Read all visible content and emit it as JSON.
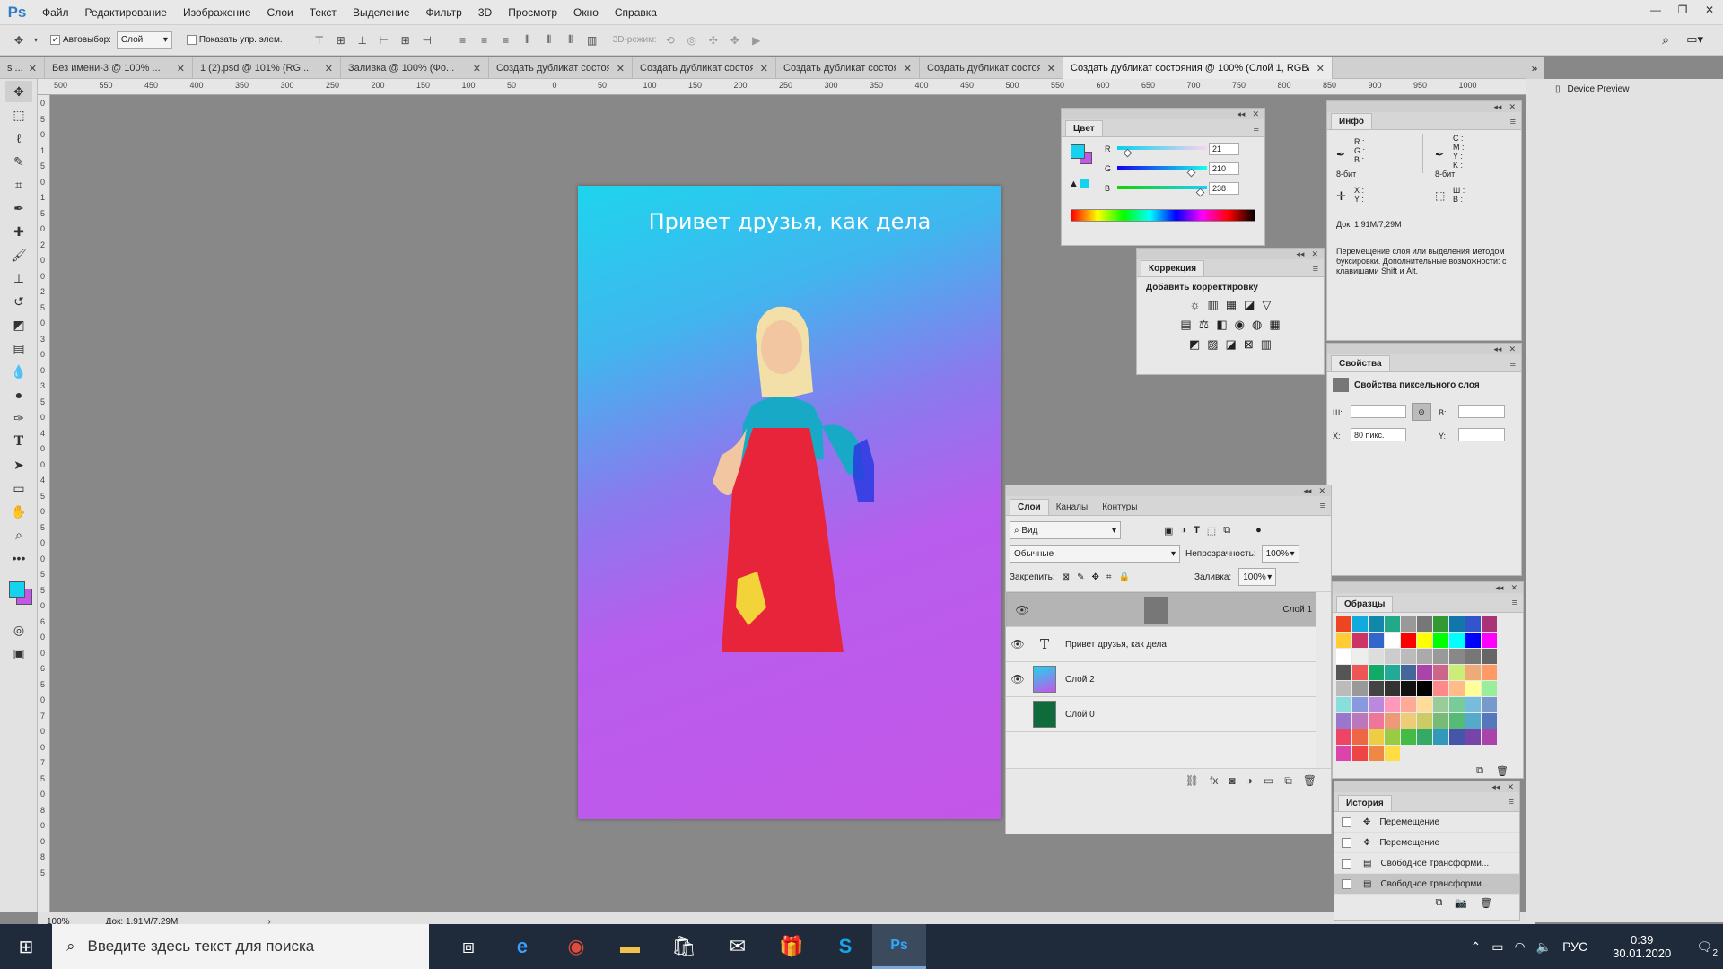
{
  "app": {
    "logo": "Ps"
  },
  "menu": [
    "Файл",
    "Редактирование",
    "Изображение",
    "Слои",
    "Текст",
    "Выделение",
    "Фильтр",
    "3D",
    "Просмотр",
    "Окно",
    "Справка"
  ],
  "options": {
    "autoselect_label": "Автовыбор:",
    "autoselect_value": "Слой",
    "show_controls_label": "Показать упр. элем.",
    "mode3d_label": "3D-режим:"
  },
  "doc_tabs": [
    {
      "label": "s ..."
    },
    {
      "label": "Без имени-3 @ 100% ..."
    },
    {
      "label": "1 (2).psd @ 101% (RG..."
    },
    {
      "label": "Заливка @ 100% (Фо..."
    },
    {
      "label": "Создать дубликат состояния"
    },
    {
      "label": "Создать дубликат состояния"
    },
    {
      "label": "Создать дубликат состояния"
    },
    {
      "label": "Создать дубликат состояния"
    },
    {
      "label": "Создать дубликат состояния @ 100% (Слой 1, RGB/16) *"
    }
  ],
  "ruler_h": [
    "500",
    "550",
    "450",
    "400",
    "350",
    "300",
    "250",
    "200",
    "150",
    "100",
    "50",
    "0",
    "50",
    "100",
    "150",
    "200",
    "250",
    "300",
    "350",
    "400",
    "450",
    "500",
    "550",
    "600",
    "650",
    "700",
    "750",
    "800",
    "850",
    "900",
    "950",
    "1000"
  ],
  "ruler_v": [
    "0",
    "5",
    "0",
    "1",
    "5",
    "0",
    "1",
    "5",
    "0",
    "2",
    "0",
    "0",
    "2",
    "5",
    "0",
    "3",
    "0",
    "0",
    "3",
    "5",
    "0",
    "4",
    "0",
    "0",
    "4",
    "5",
    "0",
    "5",
    "0",
    "0",
    "5",
    "5",
    "0",
    "6",
    "0",
    "0",
    "6",
    "5",
    "0",
    "7",
    "0",
    "0",
    "7",
    "5",
    "0",
    "8",
    "0",
    "0",
    "8",
    "5"
  ],
  "canvas": {
    "text": "Привет друзья, как дела"
  },
  "status": {
    "zoom": "100%",
    "doc": "Док: 1,91M/7,29M"
  },
  "color_panel": {
    "title": "Цвет",
    "r_label": "R",
    "g_label": "G",
    "b_label": "B",
    "r": "21",
    "g": "210",
    "b": "238",
    "r_frac": 0.08,
    "g_frac": 0.82,
    "b_frac": 0.93,
    "fg": "#15d2ee",
    "bg": "#c456e9"
  },
  "info_panel": {
    "title": "Инфо",
    "rgb_labels": "R :\nG :\nB :",
    "cmyk_labels": "C :\nM :\nY :\nK :",
    "bits1": "8-бит",
    "bits2": "8-бит",
    "xy_labels": "X :\nY :",
    "wh_labels": "Ш :\nВ :",
    "doc": "Док: 1,91M/7,29M",
    "hint": "Перемещение слоя или выделения методом буксировки. Дополнительные возможности: с клавишами Shift и Alt."
  },
  "device_preview": {
    "label": "Device Preview"
  },
  "adjust_panel": {
    "title": "Коррекция",
    "subtitle": "Добавить корректировку"
  },
  "props_panel": {
    "title": "Свойства",
    "subtitle": "Свойства пиксельного слоя",
    "w_label": "Ш:",
    "h_label": "В:",
    "x_label": "X:",
    "y_label": "Y:",
    "x_value": "80 пикс.",
    "w_value": "",
    "h_value": "",
    "y_value": ""
  },
  "layers_panel": {
    "tabs": [
      "Слои",
      "Каналы",
      "Контуры"
    ],
    "filter": "Вид",
    "blend": "Обычные",
    "opacity_label": "Непрозрачность:",
    "opacity": "100%",
    "lock_label": "Закрепить:",
    "fill_label": "Заливка:",
    "fill": "100%",
    "layers": [
      {
        "name": "Слой 1",
        "visible": true,
        "selected": true
      },
      {
        "name": "Привет друзья, как дела",
        "visible": true,
        "selected": false
      },
      {
        "name": "Слой 2",
        "visible": true,
        "selected": false
      },
      {
        "name": "Слой 0",
        "visible": false,
        "selected": false
      }
    ],
    "footer_icons": [
      "link-icon",
      "fx-icon",
      "mask-icon",
      "adjustment-icon",
      "folder-icon",
      "new-layer-icon",
      "trash-icon"
    ]
  },
  "swatches_panel": {
    "title": "Образцы"
  },
  "history_panel": {
    "title": "История",
    "items": [
      "Перемещение",
      "Перемещение",
      "Свободное трансформи...",
      "Свободное трансформи..."
    ]
  },
  "taskbar": {
    "search_placeholder": "Введите здесь текст для поиска",
    "lang": "РУС",
    "time": "0:39",
    "date": "30.01.2020",
    "notif_count": "2"
  }
}
